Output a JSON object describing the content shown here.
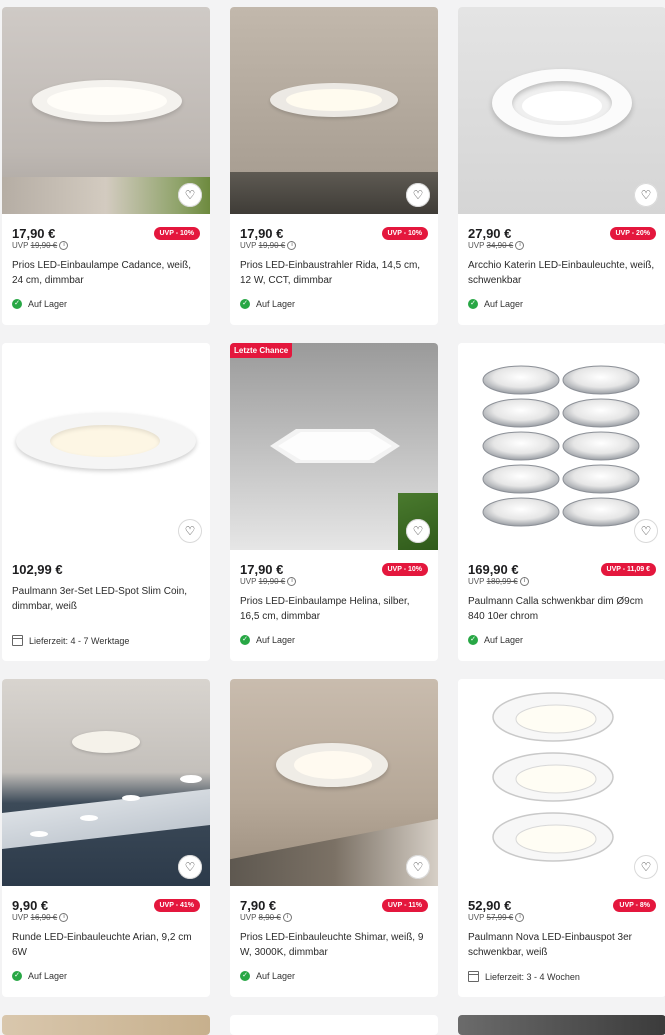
{
  "products": [
    {
      "price": "17,90 €",
      "uvp_prefix": "UVP",
      "uvp_old": "19,90 €",
      "badge": "UVP - 10%",
      "name": "Prios LED-Einbaulampe Cadance, weiß, 24 cm, dimmbar",
      "availability": "Auf Lager",
      "avail_type": "stock"
    },
    {
      "price": "17,90 €",
      "uvp_prefix": "UVP",
      "uvp_old": "19,90 €",
      "badge": "UVP - 10%",
      "name": "Prios LED-Einbaustrahler Rida, 14,5 cm, 12 W, CCT, dimmbar",
      "availability": "Auf Lager",
      "avail_type": "stock"
    },
    {
      "price": "27,90 €",
      "uvp_prefix": "UVP",
      "uvp_old": "34,90 €",
      "badge": "UVP - 20%",
      "name": "Arcchio Katerin LED-Einbauleuchte, weiß, schwenkbar",
      "availability": "Auf Lager",
      "avail_type": "stock"
    },
    {
      "price": "102,99 €",
      "uvp_prefix": "",
      "uvp_old": "",
      "badge": "",
      "name": "Paulmann 3er-Set LED-Spot Slim Coin, dimmbar, weiß",
      "availability": "Lieferzeit: 4 - 7 Werktage",
      "avail_type": "delivery"
    },
    {
      "price": "17,90 €",
      "uvp_prefix": "UVP",
      "uvp_old": "19,90 €",
      "badge": "UVP - 10%",
      "name": "Prios LED-Einbaulampe Helina, silber, 16,5 cm, dimmbar",
      "availability": "Auf Lager",
      "avail_type": "stock",
      "flag": "Letzte Chance"
    },
    {
      "price": "169,90 €",
      "uvp_prefix": "UVP",
      "uvp_old": "180,99 €",
      "badge": "UVP - 11,09 €",
      "name": "Paulmann Calla schwenkbar dim Ø9cm 840 10er chrom",
      "availability": "Auf Lager",
      "avail_type": "stock"
    },
    {
      "price": "9,90 €",
      "uvp_prefix": "UVP",
      "uvp_old": "16,90 €",
      "badge": "UVP - 41%",
      "name": "Runde LED-Einbauleuchte Arian, 9,2 cm 6W",
      "availability": "Auf Lager",
      "avail_type": "stock"
    },
    {
      "price": "7,90 €",
      "uvp_prefix": "UVP",
      "uvp_old": "8,90 €",
      "badge": "UVP - 11%",
      "name": "Prios LED-Einbauleuchte Shimar, weiß, 9 W, 3000K, dimmbar",
      "availability": "Auf Lager",
      "avail_type": "stock"
    },
    {
      "price": "52,90 €",
      "uvp_prefix": "UVP",
      "uvp_old": "57,99 €",
      "badge": "UVP - 8%",
      "name": "Paulmann Nova LED-Einbauspot 3er schwenkbar, weiß",
      "availability": "Lieferzeit: 3 - 4 Wochen",
      "avail_type": "delivery"
    }
  ],
  "colors": {
    "accent": "#e4173d",
    "stock_green": "#28a745"
  }
}
